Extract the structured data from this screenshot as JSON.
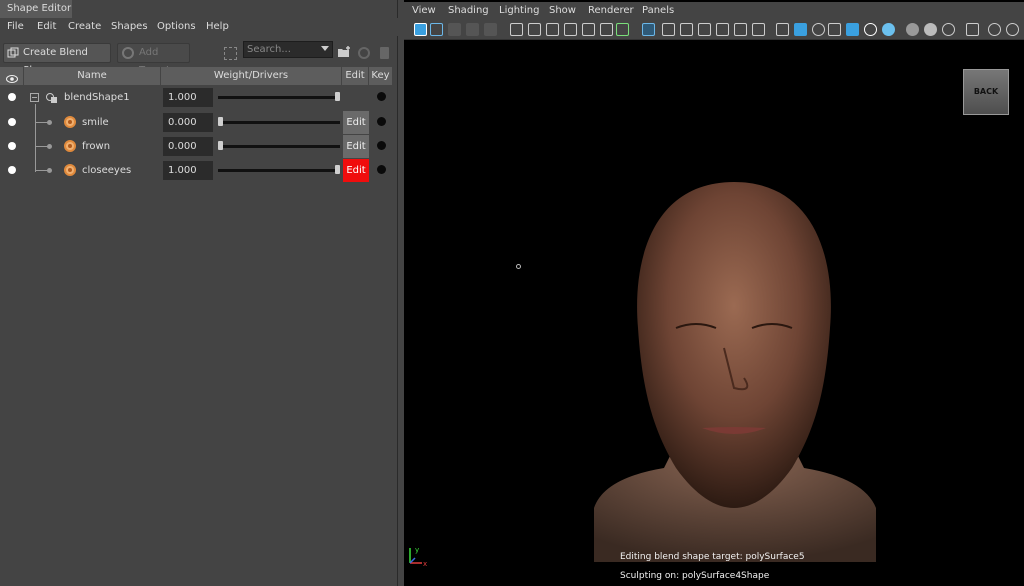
{
  "editor": {
    "title": "Shape Editor",
    "menu": [
      "File",
      "Edit",
      "Create",
      "Shapes",
      "Options",
      "Help"
    ],
    "toolbar": {
      "create_blend_shape": "Create Blend Shape",
      "add_target": "Add Target",
      "search_placeholder": "Search..."
    },
    "columns": {
      "name": "Name",
      "weight": "Weight/Drivers",
      "edit": "Edit",
      "key": "Key"
    },
    "blend_shape": {
      "name": "blendShape1",
      "weight": "1.000",
      "weight_fraction": 1.0
    },
    "targets": [
      {
        "name": "smile",
        "weight": "0.000",
        "weight_fraction": 0.0,
        "edit_label": "Edit",
        "edit_active": false
      },
      {
        "name": "frown",
        "weight": "0.000",
        "weight_fraction": 0.0,
        "edit_label": "Edit",
        "edit_active": false
      },
      {
        "name": "closeeyes",
        "weight": "1.000",
        "weight_fraction": 1.0,
        "edit_label": "Edit",
        "edit_active": true
      }
    ],
    "colors": {
      "edit_active": "#f00d0d",
      "target_icon": "#e08a3c"
    }
  },
  "viewport": {
    "menu": [
      "View",
      "Shading",
      "Lighting",
      "Show",
      "Renderer",
      "Panels"
    ],
    "back_label": "BACK",
    "hud_line1": "Editing blend shape target: polySurface5",
    "hud_line2": "Sculpting on: polySurface4Shape",
    "axis_y": "y",
    "axis_x": "x"
  }
}
